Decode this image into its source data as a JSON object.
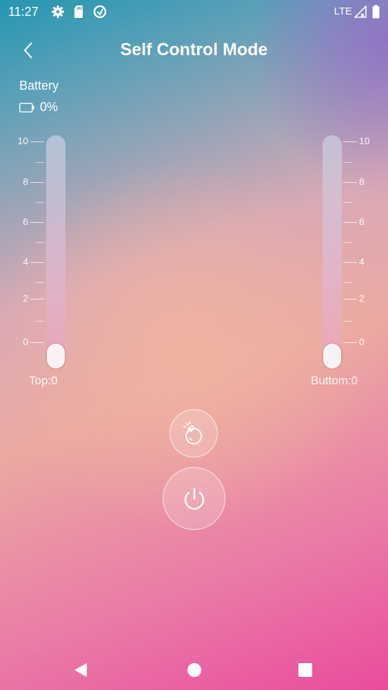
{
  "status_bar": {
    "time": "11:27",
    "network": "LTE",
    "icons": [
      "gear-icon",
      "sd-card-icon",
      "data-saver-icon",
      "signal-icon",
      "battery-icon"
    ]
  },
  "header": {
    "title": "Self Control Mode",
    "back_icon": "chevron-left-icon"
  },
  "battery": {
    "label": "Battery",
    "value": "0%",
    "level": 0
  },
  "scale_labels": [
    "10",
    "8",
    "6",
    "4",
    "2",
    "0"
  ],
  "sliders": {
    "left": {
      "label": "Top:0",
      "value": 0,
      "min": 0,
      "max": 10
    },
    "right": {
      "label": "Buttom:0",
      "value": 0,
      "min": 0,
      "max": 10
    }
  },
  "controls": {
    "bomb_icon": "bomb-icon",
    "power_icon": "power-icon"
  },
  "nav": {
    "back": "nav-back-icon",
    "home": "nav-home-icon",
    "recents": "nav-recents-icon"
  }
}
